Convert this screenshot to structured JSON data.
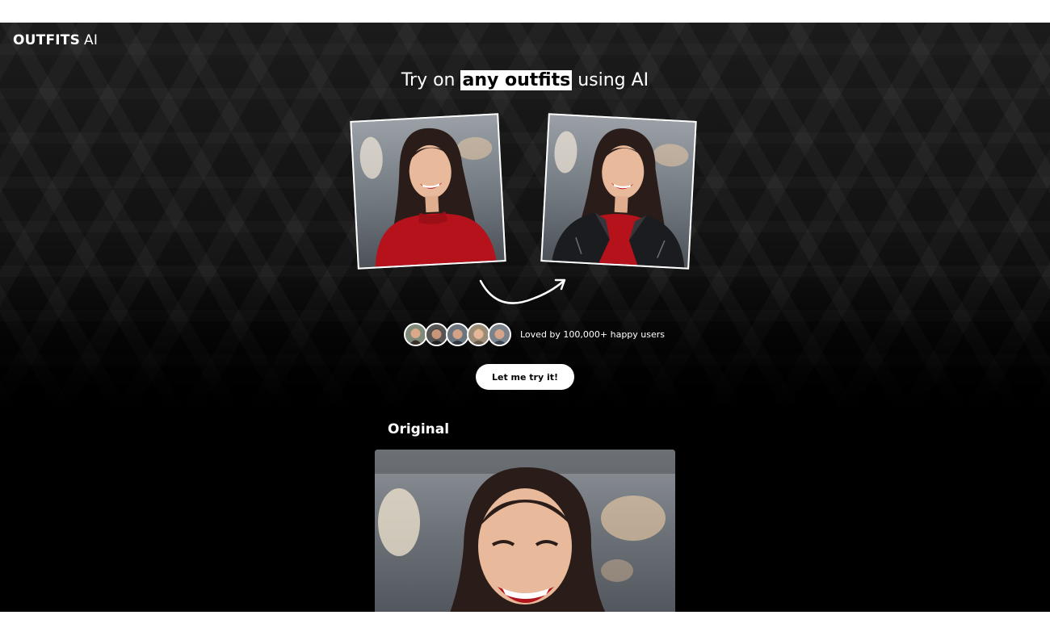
{
  "brand": {
    "name_bold": "OUTFITS",
    "name_light": "AI"
  },
  "hero": {
    "headline_pre": "Try on",
    "headline_highlight": "any outfits",
    "headline_post": "using AI"
  },
  "social_proof": {
    "text": "Loved by 100,000+ happy users",
    "avatar_count": 5
  },
  "cta": {
    "label": "Let me try it!"
  },
  "section": {
    "title": "Original"
  },
  "colors": {
    "background": "#000000",
    "text": "#ffffff",
    "highlight_bg": "#ffffff",
    "sweater": "#b5121b"
  },
  "icons": [
    "curved-arrow-icon"
  ]
}
